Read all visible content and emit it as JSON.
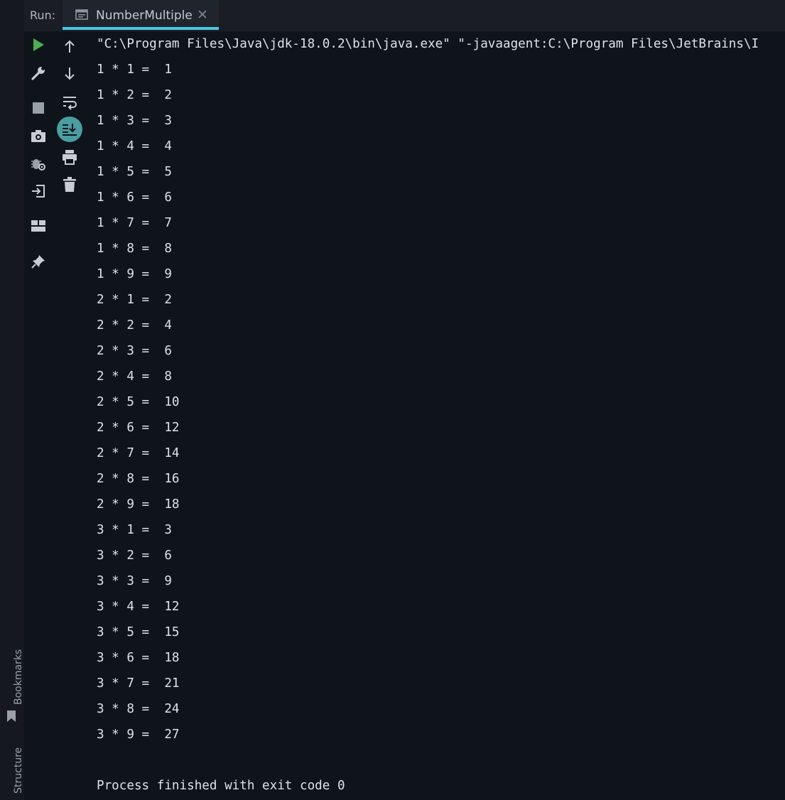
{
  "side_strip": {
    "bookmarks_label": "Bookmarks",
    "structure_label": "Structure"
  },
  "header": {
    "run_label": "Run:",
    "tab_title": "NumberMultiple",
    "tab_close_glyph": "✕"
  },
  "toolbar": {
    "icons": [
      "run-icon",
      "wrench-icon",
      "stop-icon",
      "camera-icon",
      "bug-settings-icon",
      "login-icon",
      "layout-icon",
      "pin-icon"
    ],
    "icons_col2": [
      "arrow-up-icon",
      "arrow-down-icon",
      "soft-wrap-icon",
      "scroll-to-end-icon",
      "print-icon",
      "trash-icon"
    ],
    "accent_color": "#4caf50",
    "active_color": "#4a9ea2"
  },
  "console": {
    "command": "\"C:\\Program Files\\Java\\jdk-18.0.2\\bin\\java.exe\" \"-javaagent:C:\\Program Files\\JetBrains\\I",
    "lines": [
      "1 * 1 =  1",
      "1 * 2 =  2",
      "1 * 3 =  3",
      "1 * 4 =  4",
      "1 * 5 =  5",
      "1 * 6 =  6",
      "1 * 7 =  7",
      "1 * 8 =  8",
      "1 * 9 =  9",
      "2 * 1 =  2",
      "2 * 2 =  4",
      "2 * 3 =  6",
      "2 * 4 =  8",
      "2 * 5 =  10",
      "2 * 6 =  12",
      "2 * 7 =  14",
      "2 * 8 =  16",
      "2 * 9 =  18",
      "3 * 1 =  3",
      "3 * 2 =  6",
      "3 * 3 =  9",
      "3 * 4 =  12",
      "3 * 5 =  15",
      "3 * 6 =  18",
      "3 * 7 =  21",
      "3 * 8 =  24",
      "3 * 9 =  27"
    ],
    "exit_message": "Process finished with exit code 0"
  }
}
